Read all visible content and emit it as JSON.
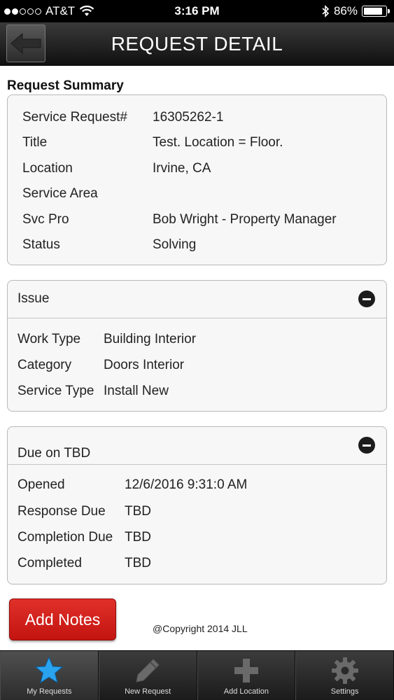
{
  "status_bar": {
    "carrier": "AT&T",
    "time": "3:16 PM",
    "battery": "86%",
    "battery_level": 0.86
  },
  "nav": {
    "title": "REQUEST DETAIL"
  },
  "summary": {
    "heading": "Request Summary",
    "rows": [
      {
        "label": "Service Request#",
        "value": "16305262-1"
      },
      {
        "label": "Title",
        "value": "Test. Location = Floor."
      },
      {
        "label": "Location",
        "value": "Irvine, CA"
      },
      {
        "label": "Service Area",
        "value": ""
      },
      {
        "label": "Svc Pro",
        "value": "Bob Wright - Property Manager"
      },
      {
        "label": "Status",
        "value": "Solving"
      }
    ]
  },
  "issue": {
    "title": "Issue",
    "rows": [
      {
        "label": "Work Type",
        "value": "Building Interior"
      },
      {
        "label": "Category",
        "value": "Doors Interior"
      },
      {
        "label": "Service Type",
        "value": "Install New"
      }
    ]
  },
  "due": {
    "title": "Due on TBD",
    "rows": [
      {
        "label": "Opened",
        "value": "12/6/2016 9:31:0 AM"
      },
      {
        "label": "Response Due",
        "value": "TBD"
      },
      {
        "label": "Completion Due",
        "value": "TBD"
      },
      {
        "label": "Completed",
        "value": "TBD"
      }
    ]
  },
  "actions": {
    "add_notes": "Add Notes",
    "copyright": "@Copyright 2014 JLL"
  },
  "tabs": [
    {
      "label": "My Requests",
      "icon": "star-icon",
      "active": true
    },
    {
      "label": "New Request",
      "icon": "pencil-icon",
      "active": false
    },
    {
      "label": "Add Location",
      "icon": "plus-icon",
      "active": false
    },
    {
      "label": "Settings",
      "icon": "gear-icon",
      "active": false
    }
  ],
  "colors": {
    "accent_button": "#d42019",
    "active_tab_icon": "#2aa3ef"
  }
}
